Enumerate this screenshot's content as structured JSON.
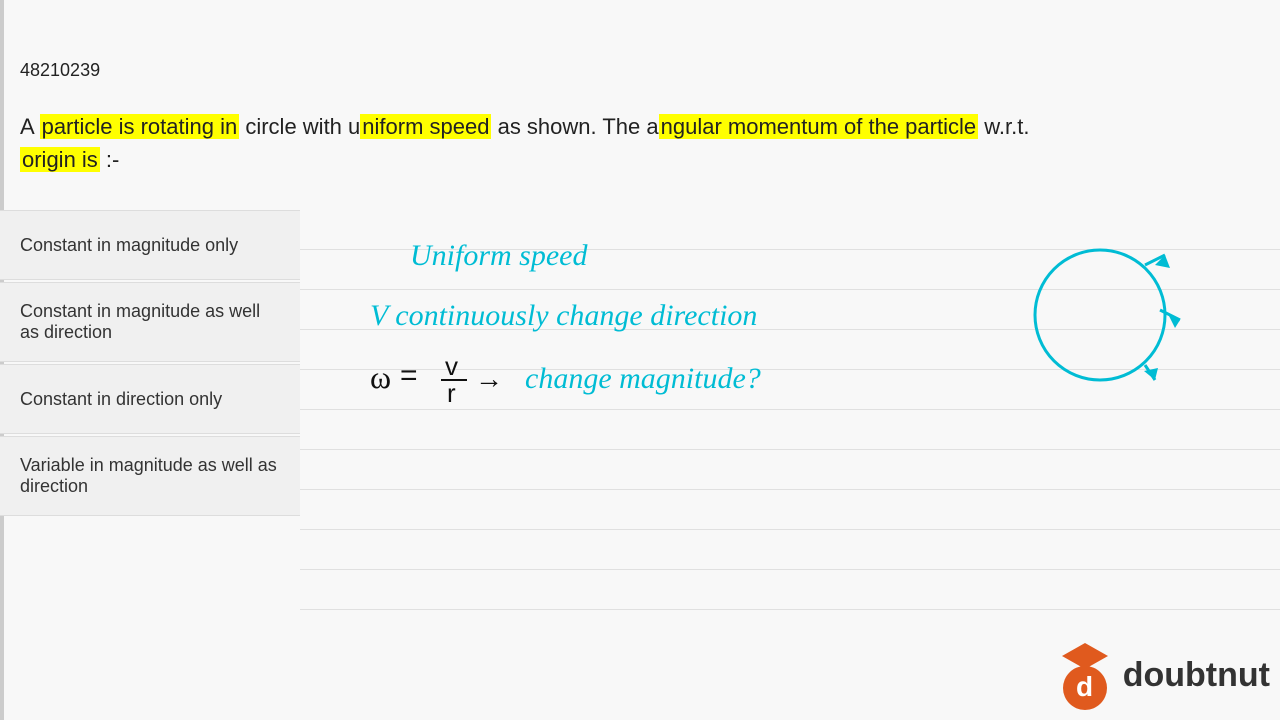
{
  "question_id": "48210239",
  "question_text_parts": [
    {
      "text": "A ",
      "style": "normal"
    },
    {
      "text": "particle is rotating in",
      "style": "highlight"
    },
    {
      "text": " circle with u",
      "style": "normal"
    },
    {
      "text": "niform speed",
      "style": "highlight"
    },
    {
      "text": " as shown. The a",
      "style": "normal"
    },
    {
      "text": "ngular momentum of the particle",
      "style": "highlight"
    },
    {
      "text": " w.r.t.",
      "style": "normal"
    }
  ],
  "question_line2_parts": [
    {
      "text": "origin is",
      "style": "highlight"
    },
    {
      "text": " :-",
      "style": "normal"
    }
  ],
  "options": [
    {
      "id": "A",
      "label": "Constant in magnitude only"
    },
    {
      "id": "B",
      "label": "Constant in magnitude as well as direction"
    },
    {
      "id": "C",
      "label": "Constant in direction only"
    },
    {
      "id": "D",
      "label": "Variable in magnitude as well as direction"
    }
  ],
  "logo": {
    "text": "doubtnut",
    "brand_color": "#e05a1e"
  },
  "colors": {
    "highlight": "#ffff00",
    "handwriting": "#00bcd4",
    "option_bg": "#f0f0f0",
    "border": "#cccccc"
  }
}
